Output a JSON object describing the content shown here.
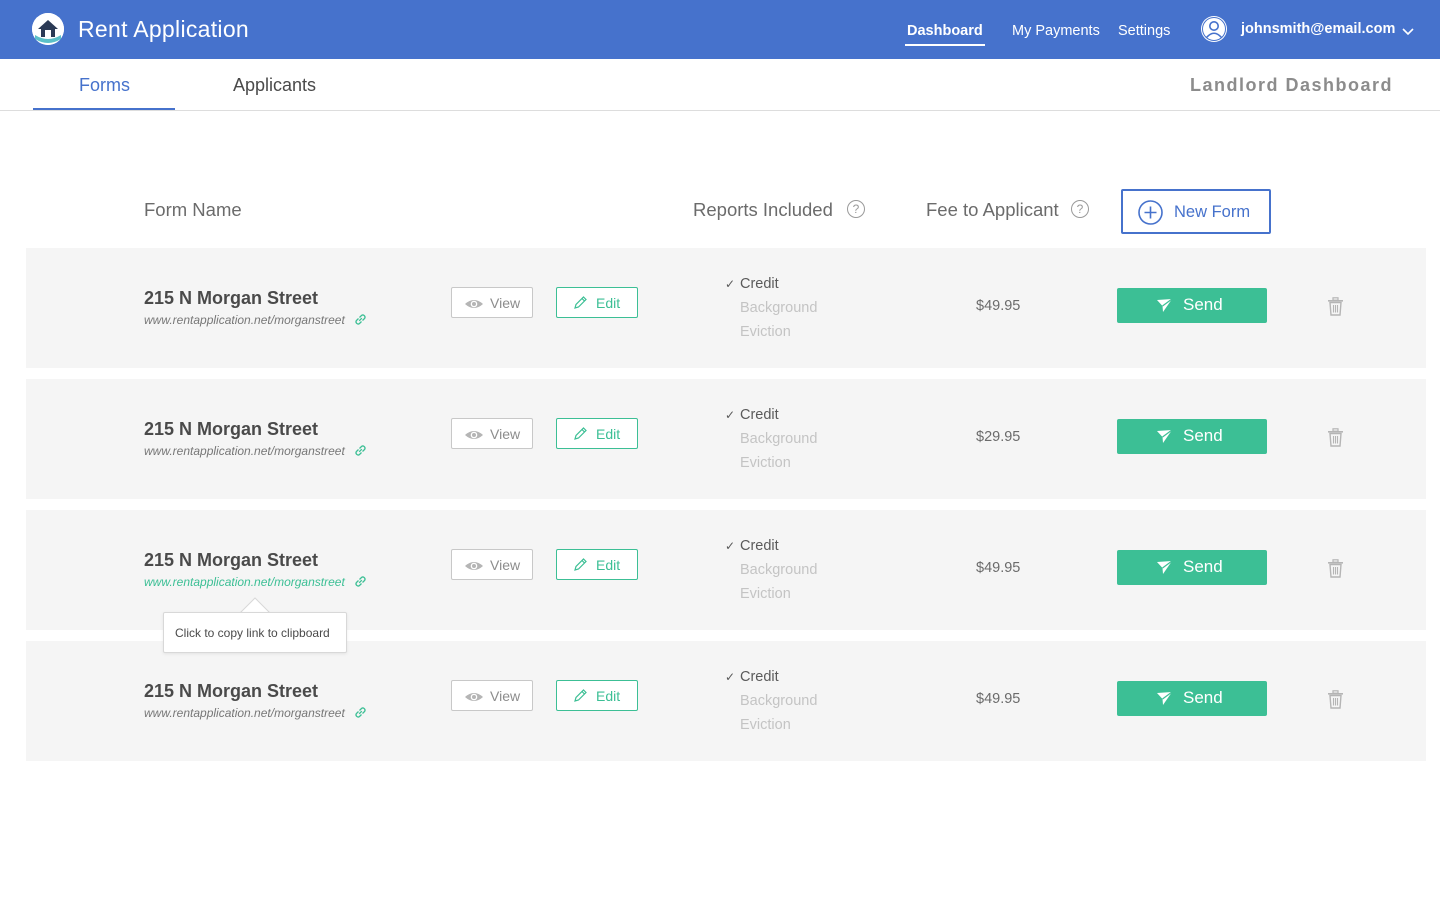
{
  "app": {
    "title": "Rent Application",
    "logo_icon": "house-logo-icon"
  },
  "nav": {
    "items": [
      {
        "label": "Dashboard",
        "active": true
      },
      {
        "label": "My Payments",
        "active": false
      },
      {
        "label": "Settings",
        "active": false
      }
    ],
    "user_email": "johnsmith@email.com"
  },
  "subnav": {
    "tabs": [
      {
        "label": "Forms",
        "active": true
      },
      {
        "label": "Applicants",
        "active": false
      }
    ],
    "section_title": "Landlord Dashboard"
  },
  "table": {
    "headers": {
      "form_name": "Form Name",
      "reports": "Reports Included",
      "fee": "Fee to Applicant",
      "help_glyph": "?"
    },
    "new_form_label": "New Form",
    "check_glyph": "✓",
    "rows": [
      {
        "name": "215 N Morgan Street",
        "link": "www.rentapplication.net/morganstreet",
        "view_label": "View",
        "edit_label": "Edit",
        "reports": [
          {
            "label": "Credit",
            "included": true
          },
          {
            "label": "Background",
            "included": false
          },
          {
            "label": "Eviction",
            "included": false
          }
        ],
        "fee": "$49.95",
        "send_label": "Send"
      },
      {
        "name": "215 N Morgan Street",
        "link": "www.rentapplication.net/morganstreet",
        "view_label": "View",
        "edit_label": "Edit",
        "reports": [
          {
            "label": "Credit",
            "included": true
          },
          {
            "label": "Background",
            "included": false
          },
          {
            "label": "Eviction",
            "included": false
          }
        ],
        "fee": "$29.95",
        "send_label": "Send"
      },
      {
        "name": "215 N Morgan Street",
        "link": "www.rentapplication.net/morganstreet",
        "link_active": true,
        "view_label": "View",
        "edit_label": "Edit",
        "reports": [
          {
            "label": "Credit",
            "included": true
          },
          {
            "label": "Background",
            "included": false
          },
          {
            "label": "Eviction",
            "included": false
          }
        ],
        "fee": "$49.95",
        "send_label": "Send"
      },
      {
        "name": "215 N Morgan Street",
        "link": "www.rentapplication.net/morganstreet",
        "view_label": "View",
        "edit_label": "Edit",
        "reports": [
          {
            "label": "Credit",
            "included": true
          },
          {
            "label": "Background",
            "included": false
          },
          {
            "label": "Eviction",
            "included": false
          }
        ],
        "fee": "$49.95",
        "send_label": "Send"
      }
    ]
  },
  "tooltip": {
    "text": "Click to copy link to clipboard"
  },
  "colors": {
    "primary_blue": "#4672cc",
    "accent_green": "#3cbf95",
    "row_bg": "#f5f5f5"
  }
}
